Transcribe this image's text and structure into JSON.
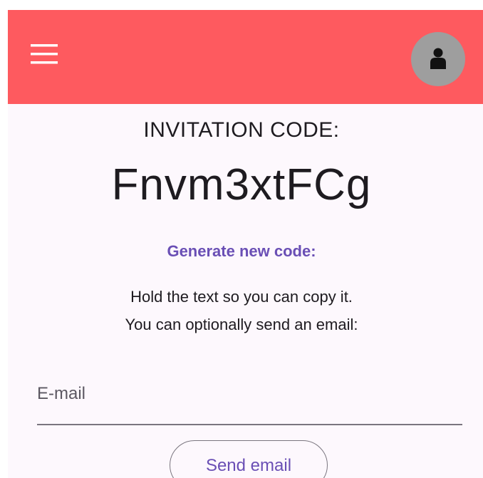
{
  "app_bar": {
    "menu_icon": "hamburger-menu-icon",
    "avatar_icon": "person-icon",
    "background_color": "#fe5a5f"
  },
  "invitation": {
    "title": "INVITATION CODE:",
    "code": "Fnvm3xtFCg",
    "generate_link": "Generate new code:",
    "hint_line1": "Hold the text so you can copy it.",
    "hint_line2": "You can optionally send an email:"
  },
  "email": {
    "placeholder": "E-mail",
    "value": ""
  },
  "actions": {
    "send_label": "Send email"
  },
  "colors": {
    "accent": "#6a4fb5",
    "surface": "#fdf8fd",
    "avatar_bg": "#9e9e9e"
  }
}
